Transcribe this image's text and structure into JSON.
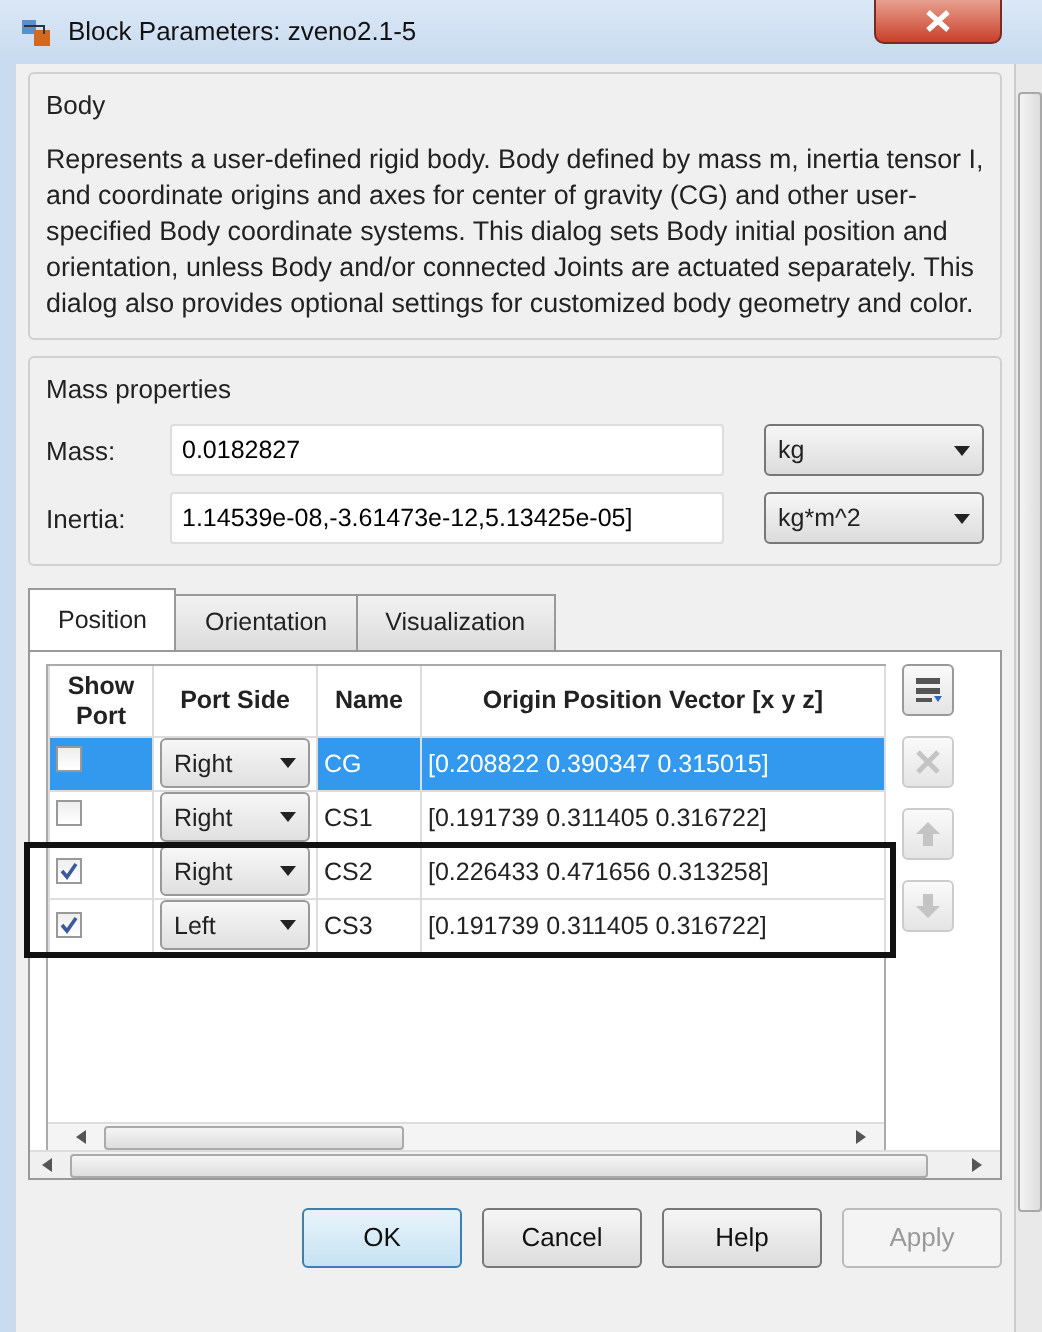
{
  "window": {
    "title": "Block Parameters: zveno2.1-5"
  },
  "body": {
    "legend": "Body",
    "description": "Represents a user-defined rigid body. Body defined by mass m, inertia tensor I, and coordinate origins and axes for center of gravity (CG) and other user-specified Body coordinate systems. This dialog sets Body initial position and orientation, unless Body and/or connected Joints are actuated separately. This dialog also provides optional settings for customized body geometry and color."
  },
  "mass_properties": {
    "legend": "Mass properties",
    "fields": [
      {
        "label": "Mass:",
        "value": "0.0182827",
        "unit": "kg"
      },
      {
        "label": "Inertia:",
        "value": "1.14539e-08,-3.61473e-12,5.13425e-05]",
        "unit": "kg*m^2"
      }
    ]
  },
  "tabs": [
    {
      "label": "Position",
      "selected": true
    },
    {
      "label": "Orientation",
      "selected": false
    },
    {
      "label": "Visualization",
      "selected": false
    }
  ],
  "table": {
    "columns": [
      "Show Port",
      "Port Side",
      "Name",
      "Origin Position Vector [x y z]"
    ],
    "rows": [
      {
        "show_port": false,
        "port_side": "Right",
        "name": "CG",
        "vector": "[0.208822 0.390347 0.315015]",
        "selected": true,
        "highlighted": false
      },
      {
        "show_port": false,
        "port_side": "Right",
        "name": "CS1",
        "vector": "[0.191739 0.311405 0.316722]",
        "selected": false,
        "highlighted": false
      },
      {
        "show_port": true,
        "port_side": "Right",
        "name": "CS2",
        "vector": "[0.226433 0.471656 0.313258]",
        "selected": false,
        "highlighted": true
      },
      {
        "show_port": true,
        "port_side": "Left",
        "name": "CS3",
        "vector": "[0.191739 0.311405 0.316722]",
        "selected": false,
        "highlighted": true
      }
    ]
  },
  "side_buttons": [
    {
      "kind": "add",
      "disabled": false
    },
    {
      "kind": "delete",
      "disabled": true
    },
    {
      "kind": "up",
      "disabled": true
    },
    {
      "kind": "down",
      "disabled": true
    }
  ],
  "buttons": [
    {
      "label": "OK",
      "default": true,
      "disabled": false
    },
    {
      "label": "Cancel",
      "default": false,
      "disabled": false
    },
    {
      "label": "Help",
      "default": false,
      "disabled": false
    },
    {
      "label": "Apply",
      "default": false,
      "disabled": true
    }
  ]
}
